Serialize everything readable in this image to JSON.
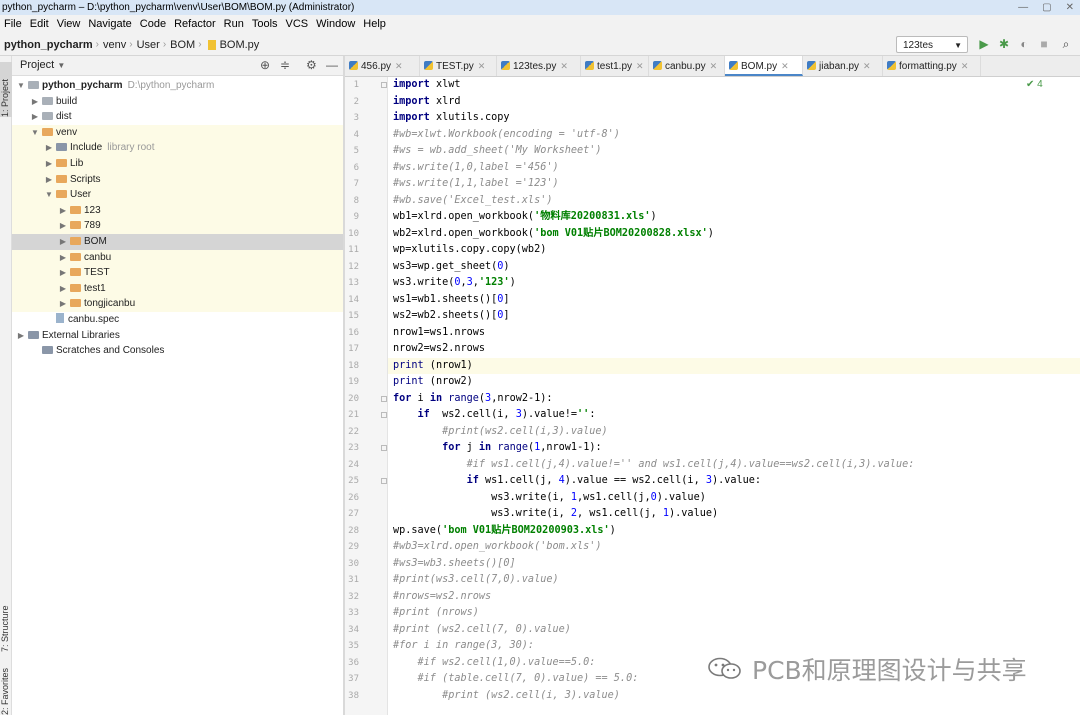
{
  "window": {
    "title": "python_pycharm – D:\\python_pycharm\\venv\\User\\BOM\\BOM.py (Administrator)",
    "controls": [
      "—",
      "▢",
      "✕"
    ]
  },
  "menu": [
    "File",
    "Edit",
    "View",
    "Navigate",
    "Code",
    "Refactor",
    "Run",
    "Tools",
    "VCS",
    "Window",
    "Help"
  ],
  "breadcrumb": [
    "python_pycharm",
    "venv",
    "User",
    "BOM",
    "BOM.py"
  ],
  "run_config": "123tes",
  "project_panel": {
    "title": "Project",
    "tree": [
      {
        "label": "python_pycharm",
        "extra": "D:\\python_pycharm",
        "arrow": "▼",
        "icon": "folder-plain",
        "bold": true,
        "venv": false
      },
      {
        "label": "build",
        "extra": "",
        "arrow": "▶",
        "icon": "folder-plain",
        "bold": false,
        "venv": false
      },
      {
        "label": "dist",
        "extra": "",
        "arrow": "▶",
        "icon": "folder-plain",
        "bold": false,
        "venv": false
      },
      {
        "label": "venv",
        "extra": "",
        "arrow": "▼",
        "icon": "folder-orange",
        "bold": false,
        "venv": true
      },
      {
        "label": "Include",
        "extra": "library root",
        "arrow": "▶",
        "icon": "folder-lib",
        "bold": false,
        "venv": true
      },
      {
        "label": "Lib",
        "extra": "",
        "arrow": "▶",
        "icon": "folder-orange",
        "bold": false,
        "venv": true
      },
      {
        "label": "Scripts",
        "extra": "",
        "arrow": "▶",
        "icon": "folder-orange",
        "bold": false,
        "venv": true
      },
      {
        "label": "User",
        "extra": "",
        "arrow": "▼",
        "icon": "folder-orange",
        "bold": false,
        "venv": true
      },
      {
        "label": "123",
        "extra": "",
        "arrow": "▶",
        "icon": "folder-orange",
        "bold": false,
        "venv": true
      },
      {
        "label": "789",
        "extra": "",
        "arrow": "▶",
        "icon": "folder-orange",
        "bold": false,
        "venv": true
      },
      {
        "label": "BOM",
        "extra": "",
        "arrow": "▶",
        "icon": "folder-orange",
        "bold": false,
        "venv": true,
        "selected": true
      },
      {
        "label": "canbu",
        "extra": "",
        "arrow": "▶",
        "icon": "folder-orange",
        "bold": false,
        "venv": true
      },
      {
        "label": "TEST",
        "extra": "",
        "arrow": "▶",
        "icon": "folder-orange",
        "bold": false,
        "venv": true
      },
      {
        "label": "test1",
        "extra": "",
        "arrow": "▶",
        "icon": "folder-orange",
        "bold": false,
        "venv": true
      },
      {
        "label": "tongjicanbu",
        "extra": "",
        "arrow": "▶",
        "icon": "folder-orange",
        "bold": false,
        "venv": true
      },
      {
        "label": "canbu.spec",
        "extra": "",
        "arrow": "",
        "icon": "file",
        "bold": false,
        "venv": false
      },
      {
        "label": "External Libraries",
        "extra": "",
        "arrow": "▶",
        "icon": "folder-lib",
        "bold": false,
        "venv": false
      },
      {
        "label": "Scratches and Consoles",
        "extra": "",
        "arrow": "",
        "icon": "folder-lib",
        "bold": false,
        "venv": false
      }
    ]
  },
  "side_labels": {
    "project": "1: Project",
    "structure": "7: Structure",
    "favorites": "2: Favorites"
  },
  "tabs": [
    {
      "label": "456.py",
      "active": false
    },
    {
      "label": "TEST.py",
      "active": false
    },
    {
      "label": "123tes.py",
      "active": false
    },
    {
      "label": "test1.py",
      "active": false
    },
    {
      "label": "canbu.py",
      "active": false
    },
    {
      "label": "BOM.py",
      "active": true
    },
    {
      "label": "jiaban.py",
      "active": false
    },
    {
      "label": "formatting.py",
      "active": false
    }
  ],
  "inspection_count": "✔ 4",
  "code_lines": [
    {
      "n": "1",
      "text": "import xlwt",
      "comment": false
    },
    {
      "n": "2",
      "text": "import xlrd",
      "comment": false
    },
    {
      "n": "3",
      "text": "import xlutils.copy",
      "comment": false
    },
    {
      "n": "4",
      "text": "#wb=xlwt.Workbook(encoding = 'utf-8')",
      "comment": true
    },
    {
      "n": "5",
      "text": "#ws = wb.add_sheet('My Worksheet')",
      "comment": true
    },
    {
      "n": "6",
      "text": "#ws.write(1,0,label ='456')",
      "comment": true
    },
    {
      "n": "7",
      "text": "#ws.write(1,1,label ='123')",
      "comment": true
    },
    {
      "n": "8",
      "text": "#wb.save('Excel_test.xls')",
      "comment": true
    },
    {
      "n": "9",
      "text": "wb1=xlrd.open_workbook('物料库20200831.xls')",
      "comment": false
    },
    {
      "n": "10",
      "text": "wb2=xlrd.open_workbook('bom V01贴片BOM20200828.xlsx')",
      "comment": false
    },
    {
      "n": "11",
      "text": "wp=xlutils.copy.copy(wb2)",
      "comment": false
    },
    {
      "n": "12",
      "text": "ws3=wp.get_sheet(0)",
      "comment": false
    },
    {
      "n": "13",
      "text": "ws3.write(0,3,'123')",
      "comment": false
    },
    {
      "n": "14",
      "text": "ws1=wb1.sheets()[0]",
      "comment": false
    },
    {
      "n": "15",
      "text": "ws2=wb2.sheets()[0]",
      "comment": false
    },
    {
      "n": "16",
      "text": "nrow1=ws1.nrows",
      "comment": false
    },
    {
      "n": "17",
      "text": "nrow2=ws2.nrows",
      "comment": false
    },
    {
      "n": "18",
      "text": "print (nrow1)",
      "comment": false,
      "current": true
    },
    {
      "n": "19",
      "text": "print (nrow2)",
      "comment": false
    },
    {
      "n": "20",
      "text": "for i in range(3,nrow2-1):",
      "comment": false
    },
    {
      "n": "21",
      "text": "    if  ws2.cell(i, 3).value!='':",
      "comment": false
    },
    {
      "n": "22",
      "text": "        #print(ws2.cell(i,3).value)",
      "comment": true
    },
    {
      "n": "23",
      "text": "        for j in range(1,nrow1-1):",
      "comment": false
    },
    {
      "n": "24",
      "text": "            #if ws1.cell(j,4).value!='' and ws1.cell(j,4).value==ws2.cell(i,3).value:",
      "comment": true
    },
    {
      "n": "25",
      "text": "            if ws1.cell(j, 4).value == ws2.cell(i, 3).value:",
      "comment": false
    },
    {
      "n": "26",
      "text": "                ws3.write(i, 1,ws1.cell(j,0).value)",
      "comment": false
    },
    {
      "n": "27",
      "text": "                ws3.write(i, 2, ws1.cell(j, 1).value)",
      "comment": false
    },
    {
      "n": "28",
      "text": "wp.save('bom V01贴片BOM20200903.xls')",
      "comment": false
    },
    {
      "n": "29",
      "text": "#wb3=xlrd.open_workbook('bom.xls')",
      "comment": true
    },
    {
      "n": "30",
      "text": "#ws3=wb3.sheets()[0]",
      "comment": true
    },
    {
      "n": "31",
      "text": "#print(ws3.cell(7,0).value)",
      "comment": true
    },
    {
      "n": "32",
      "text": "#nrows=ws2.nrows",
      "comment": true
    },
    {
      "n": "33",
      "text": "#print (nrows)",
      "comment": true
    },
    {
      "n": "34",
      "text": "#print (ws2.cell(7, 0).value)",
      "comment": true
    },
    {
      "n": "35",
      "text": "#for i in range(3, 30):",
      "comment": true
    },
    {
      "n": "36",
      "text": "    #if ws2.cell(1,0).value==5.0:",
      "comment": true
    },
    {
      "n": "37",
      "text": "    #if (table.cell(7, 0).value) == 5.0:",
      "comment": true
    },
    {
      "n": "38",
      "text": "        #print (ws2.cell(i, 3).value)",
      "comment": true
    }
  ],
  "watermark": "PCB和原理图设计与共享",
  "colors": {
    "keyword": "#000080",
    "string": "#008000",
    "number": "#0000ff",
    "comment": "#8c8c8c",
    "accent": "#4a86c8"
  }
}
